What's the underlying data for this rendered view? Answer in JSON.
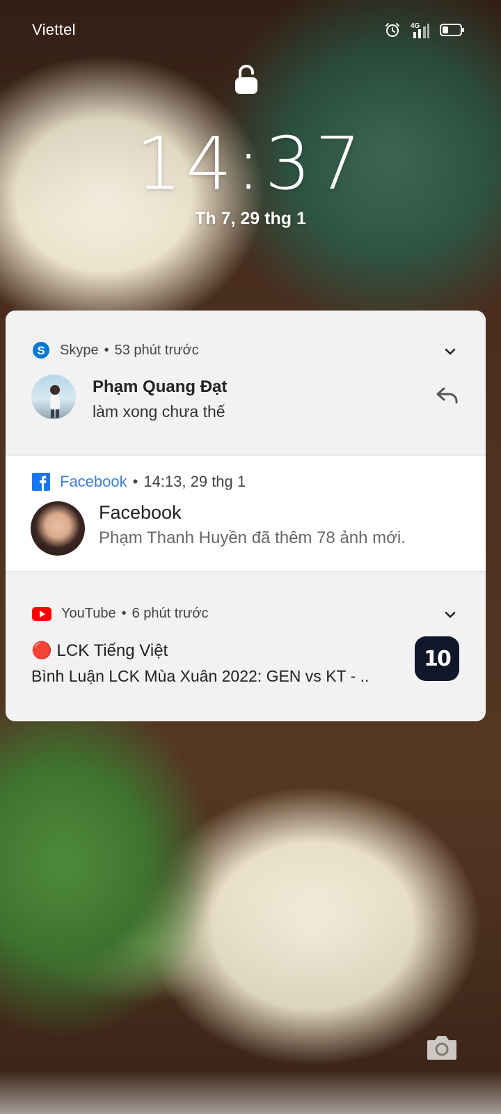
{
  "status_bar": {
    "carrier": "Viettel",
    "network": "4G",
    "icons": [
      "alarm-icon",
      "signal-icon",
      "battery-icon"
    ]
  },
  "lockscreen": {
    "time": "14:37",
    "date": "Th 7, 29 thg 1"
  },
  "notifications": {
    "skype": {
      "app": "Skype",
      "time": "53 phút trước",
      "title": "Phạm Quang Đạt",
      "text": "làm xong chưa thế",
      "accent": "#0078d4"
    },
    "facebook": {
      "app": "Facebook",
      "time": "14:13, 29 thg 1",
      "title": "Facebook",
      "text": "Phạm Thanh Huyền đã thêm 78 ảnh mới.",
      "accent": "#1877f2"
    },
    "youtube": {
      "app": "YouTube",
      "time": "6 phút trước",
      "title": "🔴 LCK Tiếng Việt",
      "text": "Bình Luận LCK Mùa Xuân 2022: GEN vs KT - ..",
      "accent": "#ff0000",
      "thumb_text": "10"
    }
  }
}
